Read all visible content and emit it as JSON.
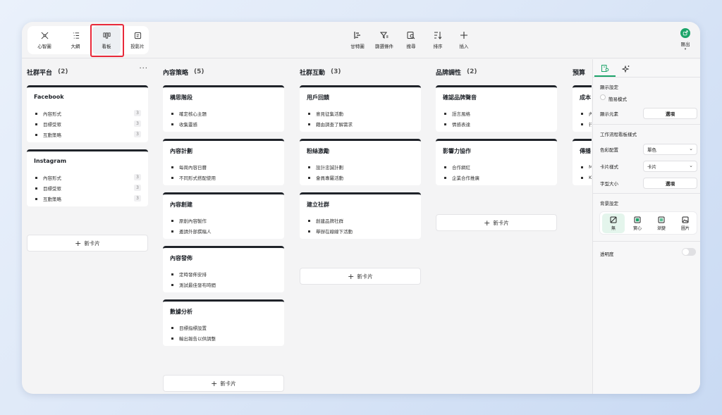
{
  "colors": {
    "accent": "#1ca469",
    "highlight": "#e8293a",
    "card_top": "#1f2329"
  },
  "toolbar": {
    "views": [
      {
        "label": "心智圖",
        "icon": "mindmap-icon"
      },
      {
        "label": "大綱",
        "icon": "outline-icon"
      },
      {
        "label": "看板",
        "icon": "kanban-icon",
        "active": true
      },
      {
        "label": "投影片",
        "icon": "slides-icon"
      }
    ],
    "tools": [
      {
        "label": "甘特圖",
        "icon": "gantt-icon"
      },
      {
        "label": "篩選條件",
        "icon": "filter-icon"
      },
      {
        "label": "搜尋",
        "icon": "search-icon"
      },
      {
        "label": "排序",
        "icon": "sort-icon"
      },
      {
        "label": "插入",
        "icon": "plus-icon"
      }
    ],
    "export_label": "匯出"
  },
  "board": {
    "add_card_label": "新卡片",
    "more": "···",
    "columns": [
      {
        "title": "社群平台",
        "count": "(2)",
        "cards": [
          {
            "title": "Facebook",
            "items": [
              "內容形式",
              "目標受眾",
              "互動策略"
            ],
            "sub": [
              "3",
              "3",
              "3"
            ]
          },
          {
            "title": "Instagram",
            "items": [
              "內容形式",
              "目標受眾",
              "互動策略"
            ],
            "sub": [
              "3",
              "3",
              "3"
            ]
          }
        ]
      },
      {
        "title": "內容策略",
        "count": "(5)",
        "cards": [
          {
            "title": "構思階段",
            "items": [
              "確定核心主題",
              "收集靈感"
            ]
          },
          {
            "title": "內容計劃",
            "items": [
              "每周內容日曆",
              "不同形式搭配使用"
            ]
          },
          {
            "title": "內容創建",
            "items": [
              "原創內容製作",
              "邀請外部撰稿人"
            ]
          },
          {
            "title": "內容發佈",
            "items": [
              "定時發佈安排",
              "測試最佳發布時間"
            ]
          },
          {
            "title": "數據分析",
            "items": [
              "目標指標設置",
              "輸出報告以供調整"
            ]
          }
        ]
      },
      {
        "title": "社群互動",
        "count": "(3)",
        "cards": [
          {
            "title": "用戶回饋",
            "items": [
              "意見征集活動",
              "藉由調查了解需求"
            ]
          },
          {
            "title": "粉絲激勵",
            "items": [
              "設計忠誠計劃",
              "會員專屬活動"
            ]
          },
          {
            "title": "建立社群",
            "items": [
              "創建品牌社群",
              "舉辦在線線下活動"
            ]
          }
        ]
      },
      {
        "title": "品牌調性",
        "count": "(2)",
        "cards": [
          {
            "title": "確認品牌聲音",
            "items": [
              "語言風格",
              "情感表達"
            ]
          },
          {
            "title": "影響力協作",
            "items": [
              "合作網紅",
              "企業合作推廣"
            ]
          }
        ]
      },
      {
        "title": "預算",
        "cards": [
          {
            "title": "成本",
            "items": [
              "內",
              "行"
            ]
          },
          {
            "title": "傳播",
            "items": [
              "M",
              "K"
            ]
          }
        ]
      }
    ]
  },
  "panel": {
    "tabs": [
      {
        "icon": "board-settings-icon"
      },
      {
        "icon": "sparkle-icon"
      }
    ],
    "display_settings": "顯示設定",
    "simple_mode": "簡易模式",
    "display_elements": "顯示元素",
    "select_btn": "選項",
    "workflow_style": "工作流程看板樣式",
    "color_scheme_label": "色彩配置",
    "color_scheme_value": "單色",
    "card_style_label": "卡片樣式",
    "card_style_value": "卡片",
    "font_size_label": "字型大小",
    "font_size_btn": "選項",
    "background_label": "背景設定",
    "bg_options": [
      {
        "label": "無",
        "icon": "none-icon",
        "active": true
      },
      {
        "label": "實心",
        "icon": "solid-icon"
      },
      {
        "label": "漸變",
        "icon": "gradient-icon"
      },
      {
        "label": "圖片",
        "icon": "image-icon"
      }
    ],
    "opacity_label": "透明度"
  }
}
